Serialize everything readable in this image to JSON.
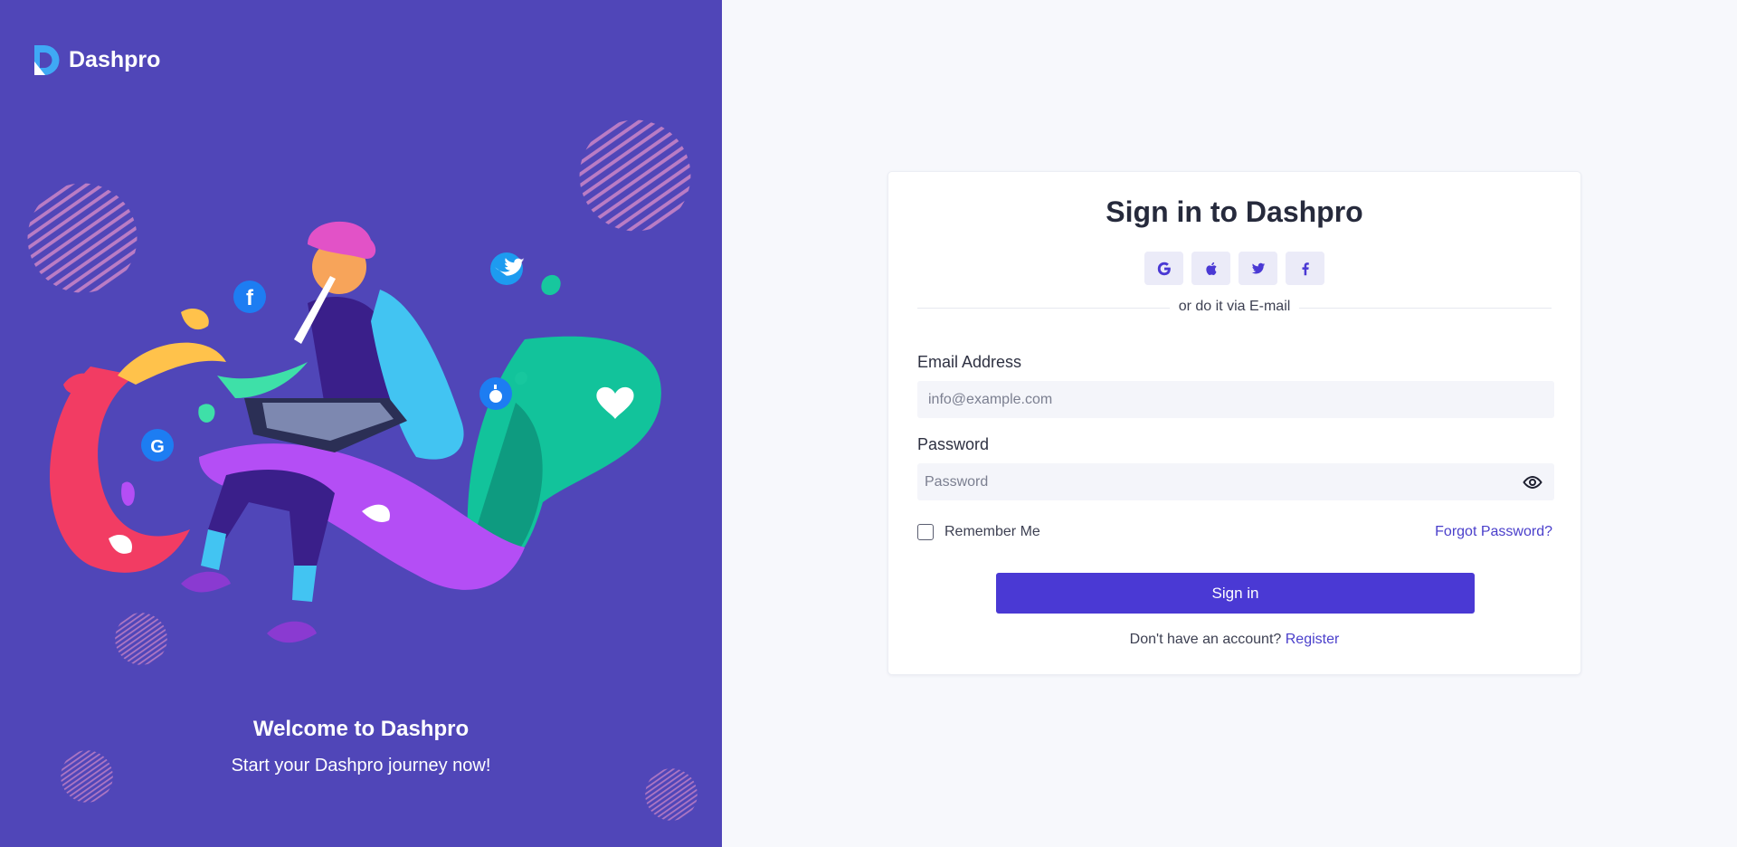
{
  "brand": {
    "name": "Dashpro"
  },
  "hero": {
    "title": "Welcome to Dashpro",
    "subtitle": "Start your Dashpro journey now!"
  },
  "signin": {
    "title": "Sign in to Dashpro",
    "social_icons": [
      "google-icon",
      "apple-icon",
      "twitter-icon",
      "facebook-icon"
    ],
    "divider_text": "or do it via E-mail",
    "email_label": "Email Address",
    "email_placeholder": "info@example.com",
    "password_label": "Password",
    "password_placeholder": "Password",
    "remember_label": "Remember Me",
    "forgot_label": "Forgot Password?",
    "button_label": "Sign in",
    "register_prompt": "Don't have an account?",
    "register_link": "Register"
  },
  "colors": {
    "hero_bg": "#5046b8",
    "accent": "#4a39d4",
    "link": "#4a3fcb",
    "page_bg": "#f7f8fc"
  }
}
